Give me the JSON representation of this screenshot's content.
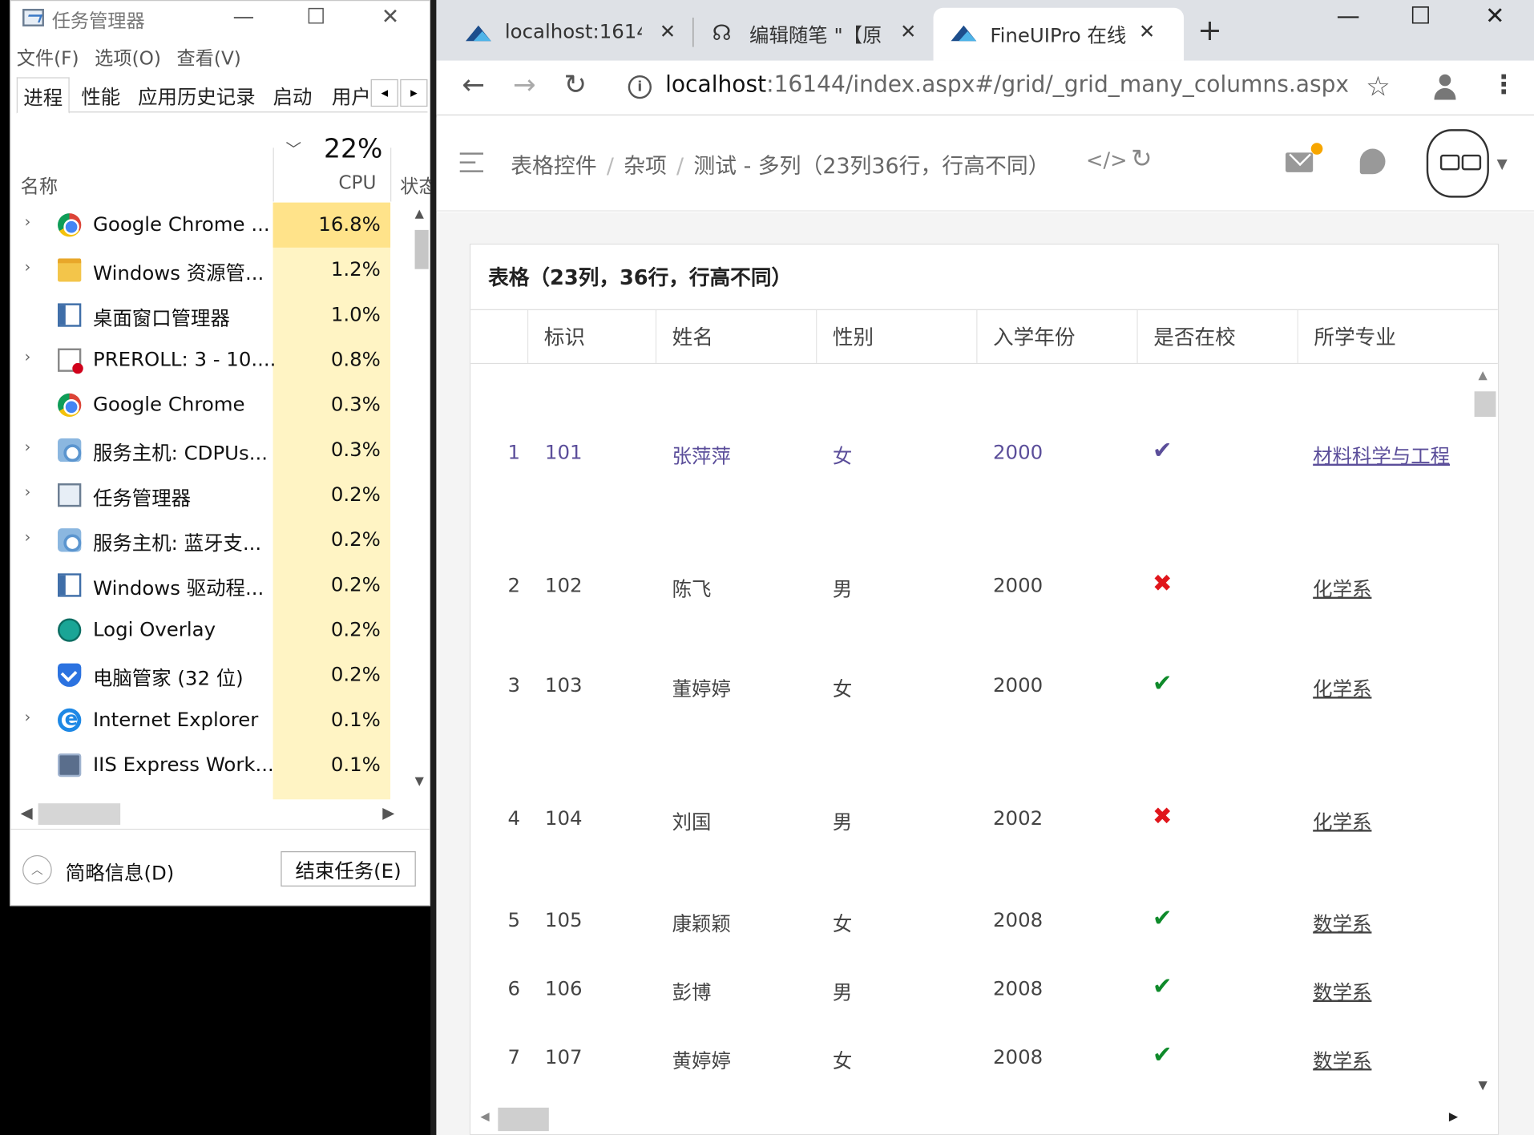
{
  "taskmgr": {
    "title": "任务管理器",
    "win_minimize": "—",
    "win_maximize": "☐",
    "win_close": "✕",
    "menu": [
      "文件(F)",
      "选项(O)",
      "查看(V)"
    ],
    "tabs": [
      "进程",
      "性能",
      "应用历史记录",
      "启动",
      "用户"
    ],
    "tab_prev": "◂",
    "tab_next": "▸",
    "cpu_total": "22%",
    "col_name": "名称",
    "col_cpu": "CPU",
    "col_status": "状态",
    "sort_indicator": "﹀",
    "processes": [
      {
        "expand": "›",
        "icon": "chrome-icon",
        "name": "Google Chrome ...",
        "cpu": "16.8%"
      },
      {
        "expand": "›",
        "icon": "folder-icon",
        "name": "Windows 资源管...",
        "cpu": "1.2%"
      },
      {
        "expand": "",
        "icon": "window-icon",
        "name": "桌面窗口管理器",
        "cpu": "1.0%"
      },
      {
        "expand": "›",
        "icon": "preroll-icon",
        "name": "PREROLL: 3 - 10....",
        "cpu": "0.8%"
      },
      {
        "expand": "",
        "icon": "chrome-icon",
        "name": "Google Chrome",
        "cpu": "0.3%"
      },
      {
        "expand": "›",
        "icon": "gear-icon",
        "name": "服务主机: CDPUs...",
        "cpu": "0.3%"
      },
      {
        "expand": "›",
        "icon": "taskmanager-icon",
        "name": "任务管理器",
        "cpu": "0.2%"
      },
      {
        "expand": "›",
        "icon": "gear-icon",
        "name": "服务主机: 蓝牙支...",
        "cpu": "0.2%"
      },
      {
        "expand": "",
        "icon": "window-icon",
        "name": "Windows 驱动程...",
        "cpu": "0.2%"
      },
      {
        "expand": "",
        "icon": "logi-icon",
        "name": "Logi Overlay",
        "cpu": "0.2%"
      },
      {
        "expand": "",
        "icon": "shield-icon",
        "name": "电脑管家 (32 位)",
        "cpu": "0.2%"
      },
      {
        "expand": "›",
        "icon": "ie-icon",
        "name": "Internet Explorer",
        "cpu": "0.1%"
      },
      {
        "expand": "",
        "icon": "iis-icon",
        "name": "IIS Express Work...",
        "cpu": "0.1%"
      }
    ],
    "fewer_details": "简略信息(D)",
    "end_task": "结束任务(E)"
  },
  "browser": {
    "tabs": [
      {
        "label": "localhost:1614",
        "close": "✕"
      },
      {
        "label": "编辑随笔 \"【原",
        "close": "✕"
      },
      {
        "label": "FineUIPro 在线",
        "close": "✕"
      }
    ],
    "new_tab": "+",
    "win_minimize": "—",
    "win_maximize": "☐",
    "win_close": "✕",
    "back": "←",
    "forward": "→",
    "reload": "↻",
    "info": "i",
    "url_host": "localhost",
    "url_rest": ":16144/index.aspx#/grid/_grid_many_columns.aspx",
    "star": "☆",
    "kebab": "⋮"
  },
  "app": {
    "breadcrumb": [
      "表格控件",
      "杂项",
      "测试 - 多列（23列36行，行高不同）"
    ],
    "crumb_sep": "/",
    "code_icon": "</>",
    "refresh_icon": "↻",
    "avatar_caret": "▼",
    "panel_title": "表格（23列，36行，行高不同）",
    "columns": [
      "",
      "标识",
      "姓名",
      "性别",
      "入学年份",
      "是否在校",
      "所学专业"
    ],
    "rows": [
      {
        "no": "1",
        "id": "101",
        "name": "张萍萍",
        "gender": "女",
        "year": "2000",
        "enrolled": true,
        "major": "材料科学与工程"
      },
      {
        "no": "2",
        "id": "102",
        "name": "陈飞",
        "gender": "男",
        "year": "2000",
        "enrolled": false,
        "major": "化学系"
      },
      {
        "no": "3",
        "id": "103",
        "name": "董婷婷",
        "gender": "女",
        "year": "2000",
        "enrolled": true,
        "major": "化学系"
      },
      {
        "no": "4",
        "id": "104",
        "name": "刘国",
        "gender": "男",
        "year": "2002",
        "enrolled": false,
        "major": "化学系"
      },
      {
        "no": "5",
        "id": "105",
        "name": "康颖颖",
        "gender": "女",
        "year": "2008",
        "enrolled": true,
        "major": "数学系"
      },
      {
        "no": "6",
        "id": "106",
        "name": "彭博",
        "gender": "男",
        "year": "2008",
        "enrolled": true,
        "major": "数学系"
      },
      {
        "no": "7",
        "id": "107",
        "name": "黄婷婷",
        "gender": "女",
        "year": "2008",
        "enrolled": true,
        "major": "数学系"
      }
    ],
    "check_glyph": "✔",
    "cross_glyph": "✖",
    "scroll_up": "▲",
    "scroll_down": "▼",
    "scroll_left": "◀",
    "scroll_right": "▶",
    "colors": {
      "check": "#0e8a2a",
      "cross": "#e0151b",
      "selected_text": "#5b4e9a",
      "cpu_hot": "#ffe38a",
      "cpu_col": "#fff4c4"
    }
  }
}
